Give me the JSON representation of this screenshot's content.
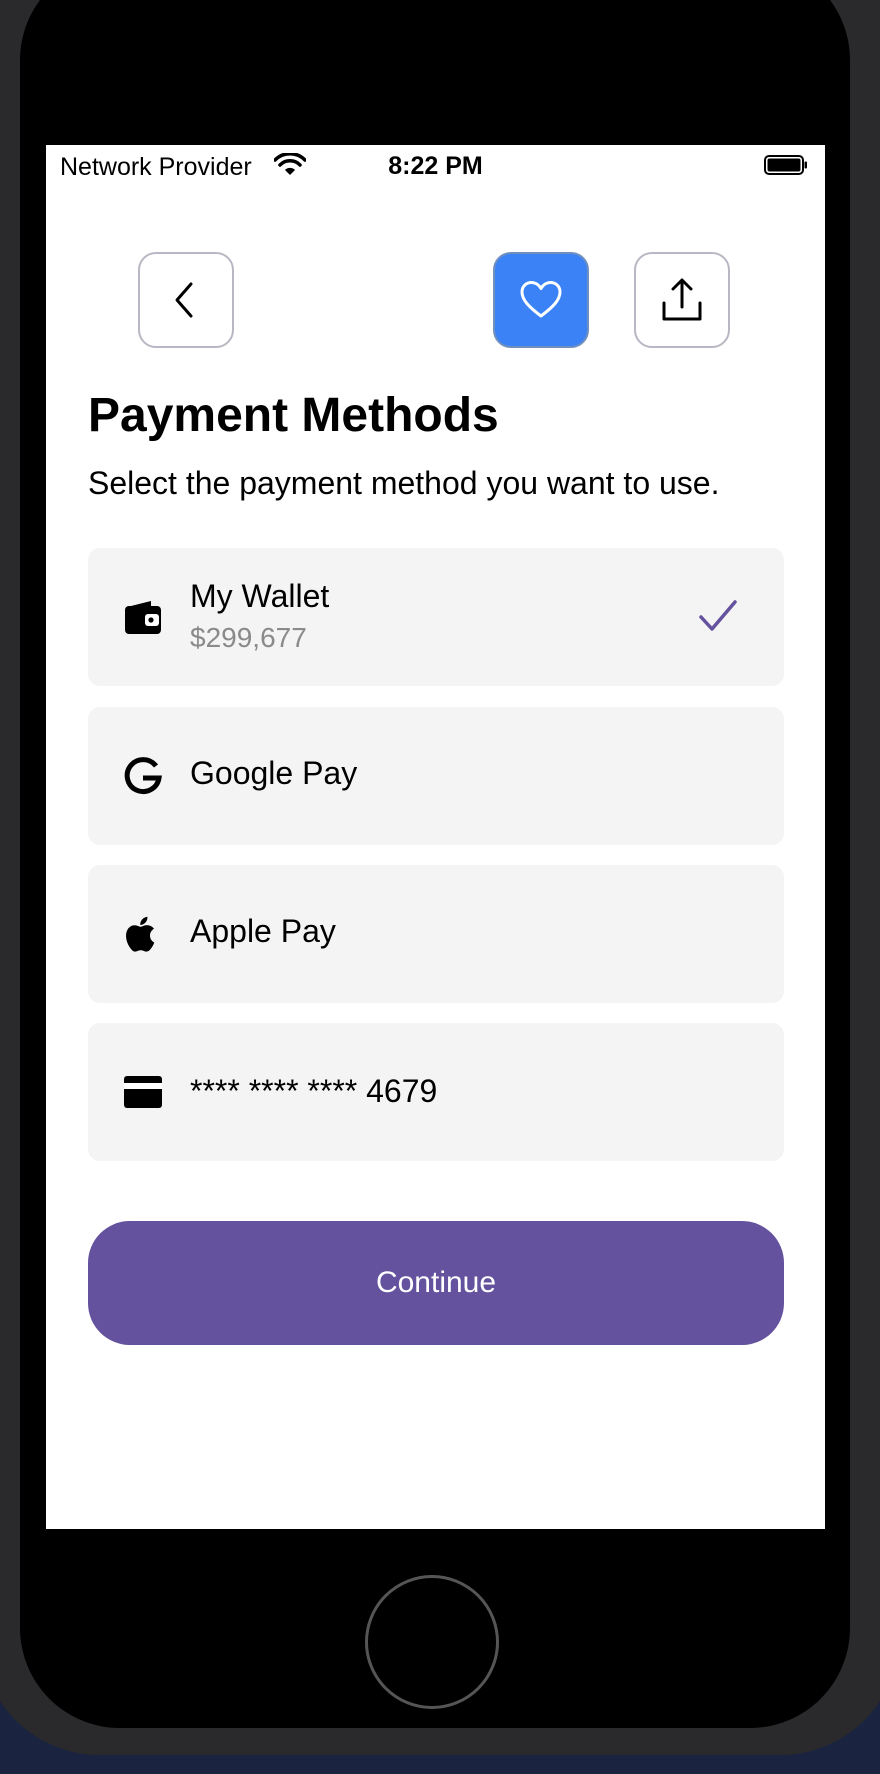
{
  "status_bar": {
    "provider": "Network Provider",
    "time": "8:22 PM"
  },
  "header": {
    "back_icon": "chevron-left-icon",
    "favorite_icon": "heart-icon",
    "share_icon": "share-icon",
    "favorite_color": "#3b82f6"
  },
  "page": {
    "title": "Payment Methods",
    "subtitle": "Select the payment method you want to use."
  },
  "methods": [
    {
      "label": "My Wallet",
      "sub": "$299,677",
      "icon": "wallet-icon",
      "selected": true
    },
    {
      "label": "Google Pay",
      "icon": "google-icon",
      "selected": false
    },
    {
      "label": "Apple Pay",
      "icon": "apple-icon",
      "selected": false
    },
    {
      "label": "**** **** **** 4679",
      "icon": "credit-card-icon",
      "selected": false
    }
  ],
  "actions": {
    "continue_label": "Continue",
    "accent_color": "#64529e"
  }
}
